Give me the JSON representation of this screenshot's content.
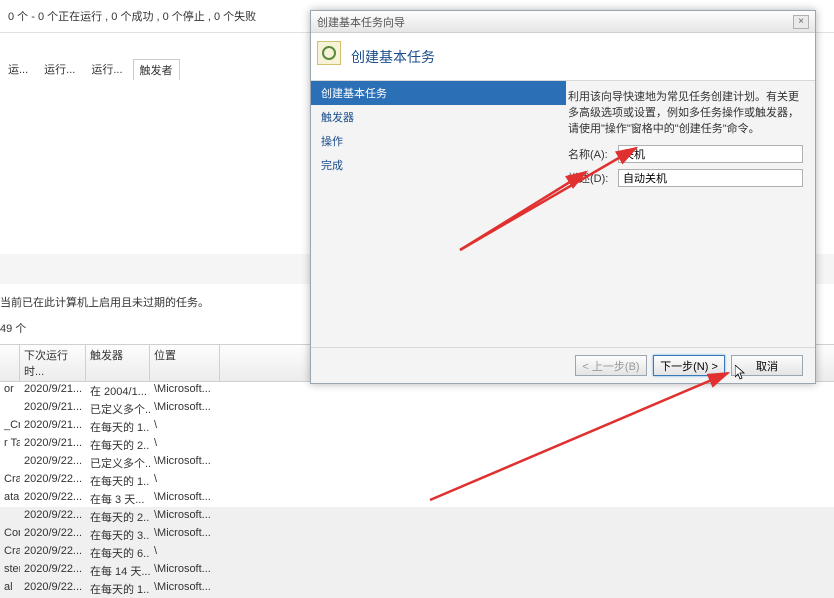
{
  "background": {
    "status": "0 个 - 0 个正在运行 , 0 个成功 , 0 个停止 , 0 个失败",
    "tabs": [
      "运...",
      "运行...",
      "运行...",
      "触发者"
    ],
    "info": "当前已在此计算机上启用且未过期的任务。",
    "count": "49 个",
    "headers": {
      "h2": "下次运行时...",
      "h3": "触发器",
      "h4": "位置"
    },
    "rows": [
      {
        "c1": "or",
        "c2": "2020/9/21...",
        "c3": "在 2004/1...",
        "c4": "\\Microsoft..."
      },
      {
        "c1": "",
        "c2": "2020/9/21...",
        "c3": "已定义多个...",
        "c4": "\\Microsoft..."
      },
      {
        "c1": "_Cras...",
        "c2": "2020/9/21...",
        "c3": "在每天的 1...",
        "c4": "\\"
      },
      {
        "c1": "r Ta...",
        "c2": "2020/9/21...",
        "c3": "在每天的 2...",
        "c4": "\\"
      },
      {
        "c1": "",
        "c2": "2020/9/22...",
        "c3": "已定义多个...",
        "c4": "\\Microsoft..."
      },
      {
        "c1": "Cras...",
        "c2": "2020/9/22...",
        "c3": "在每天的 1...",
        "c4": "\\"
      },
      {
        "c1": "ataU...",
        "c2": "2020/9/22...",
        "c3": "在每 3 天...",
        "c4": "\\Microsoft..."
      },
      {
        "c1": "",
        "c2": "2020/9/22...",
        "c3": "在每天的 2...",
        "c4": "\\Microsoft..."
      },
      {
        "c1": "Com...",
        "c2": "2020/9/22...",
        "c3": "在每天的 3...",
        "c4": "\\Microsoft..."
      },
      {
        "c1": "Cras...",
        "c2": "2020/9/22...",
        "c3": "在每天的 6...",
        "c4": "\\"
      },
      {
        "c1": "stem",
        "c2": "2020/9/22...",
        "c3": "在每 14 天...",
        "c4": "\\Microsoft..."
      },
      {
        "c1": "al",
        "c2": "2020/9/22...",
        "c3": "在每天的 1...",
        "c4": "\\Microsoft..."
      }
    ]
  },
  "wizard": {
    "title": "创建基本任务向导",
    "heading": "创建基本任务",
    "nav": [
      "创建基本任务",
      "触发器",
      "操作",
      "完成"
    ],
    "description": "利用该向导快速地为常见任务创建计划。有关更多高级选项或设置，例如多任务操作或触发器，请使用\"操作\"窗格中的\"创建任务\"命令。",
    "name_label": "名称(A):",
    "name_value": "关机",
    "desc_label": "描述(D):",
    "desc_value": "自动关机",
    "btn_back": "< 上一步(B)",
    "btn_next": "下一步(N) >",
    "btn_cancel": "取消",
    "close": "×"
  }
}
